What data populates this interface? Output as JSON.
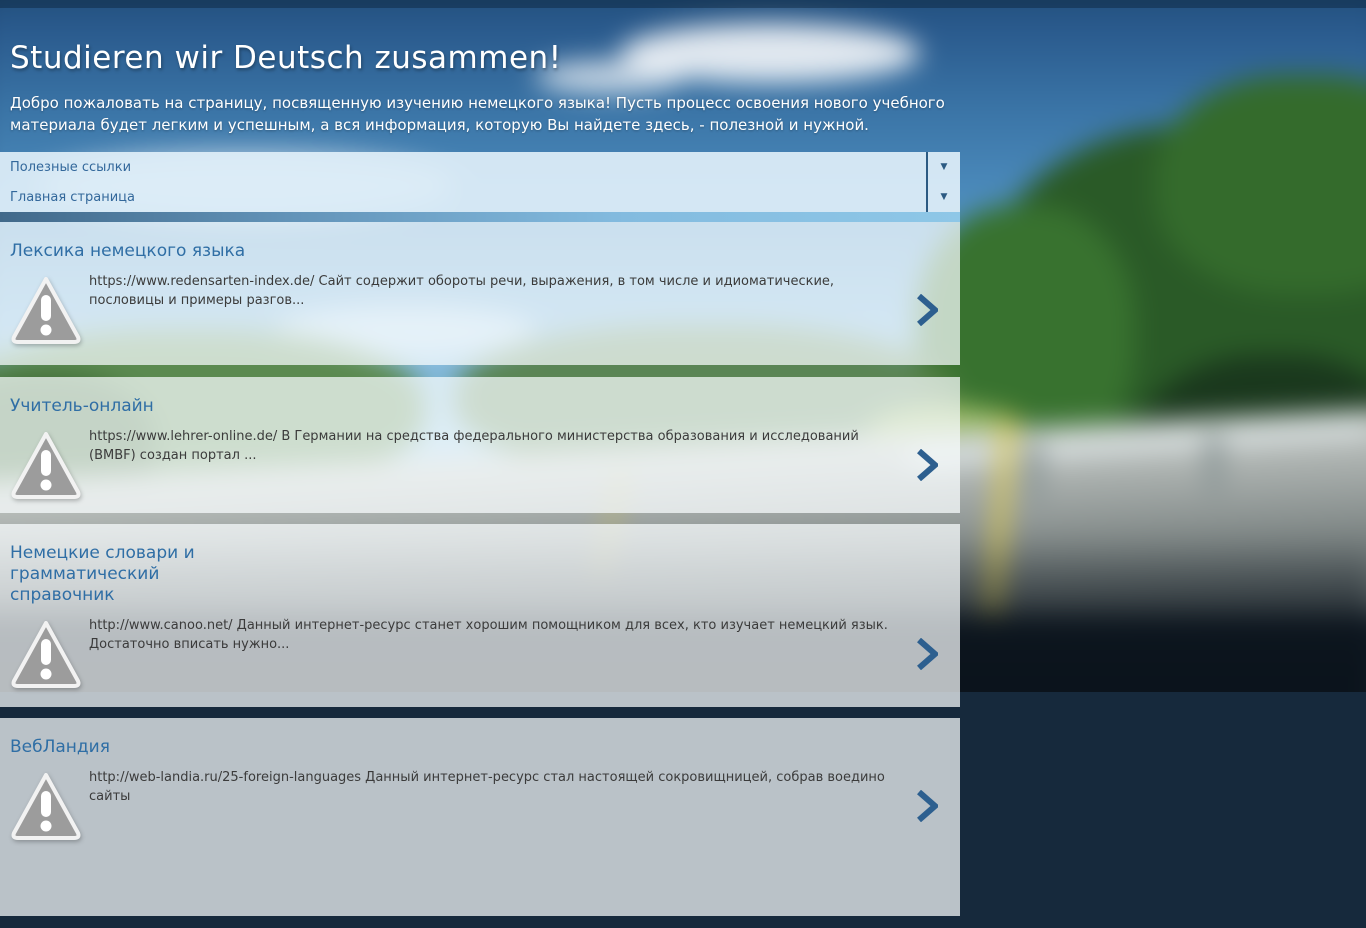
{
  "header": {
    "title": "Studieren wir Deutsch zusammen!",
    "description": "Добро пожаловать на страницу, посвященную изучению немецкого языка! Пусть процесс освоения нового учебного материала будет легким и успешным, а вся информация, которую Вы найдете здесь, - полезной и нужной."
  },
  "nav": {
    "items": [
      {
        "label": "Полезные ссылки",
        "arrow": "▼",
        "icon": "dropdown-arrow-icon"
      },
      {
        "label": "Главная страница",
        "arrow": "▼",
        "icon": "dropdown-arrow-icon"
      }
    ]
  },
  "posts": [
    {
      "title": "Лексика немецкого языка",
      "snippet": "https://www.redensarten-index.de/ Сайт содержит обороты речи, выражения, в том числе и идиоматические, пословицы и примеры разгов...",
      "icon": "warning-triangle-icon",
      "chevron": "chevron-right-icon"
    },
    {
      "title": "Учитель-онлайн",
      "snippet": "https://www.lehrer-online.de/ В Германии на средства федерального министерства образования и исследований (BMBF) создан портал ...",
      "icon": "warning-triangle-icon",
      "chevron": "chevron-right-icon"
    },
    {
      "title": "Немецкие словари и грамматический справочник",
      "snippet": "http://www.canoo.net/ Данный интернет-ресурс станет хорошим помощником для всех, кто изучает немецкий язык. Достаточно вписать нужно...",
      "icon": "warning-triangle-icon",
      "chevron": "chevron-right-icon"
    },
    {
      "title": "ВебЛандия",
      "snippet": "http://web-landia.ru/25-foreign-languages Данный интернет-ресурс стал настоящей сокровищницей, собрав воедино сайты",
      "icon": "warning-triangle-icon",
      "chevron": "chevron-right-icon"
    }
  ],
  "colors": {
    "nav_link": "#33689b",
    "post_title": "#2f6ea5",
    "chevron": "#2d5f8f",
    "nav_divider": "#2b5a82",
    "top_bar": "#0d2742"
  }
}
